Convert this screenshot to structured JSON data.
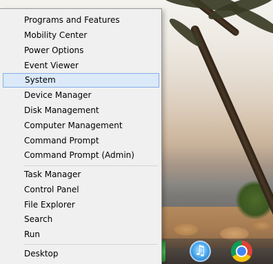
{
  "context_menu": {
    "items": [
      {
        "id": "programs-features",
        "label": "Programs and Features"
      },
      {
        "id": "mobility-center",
        "label": "Mobility Center"
      },
      {
        "id": "power-options",
        "label": "Power Options"
      },
      {
        "id": "event-viewer",
        "label": "Event Viewer"
      },
      {
        "id": "system",
        "label": "System",
        "highlighted": true
      },
      {
        "id": "device-manager",
        "label": "Device Manager"
      },
      {
        "id": "disk-management",
        "label": "Disk Management"
      },
      {
        "id": "computer-management",
        "label": "Computer Management"
      },
      {
        "id": "command-prompt",
        "label": "Command Prompt"
      },
      {
        "id": "command-prompt-admin",
        "label": "Command Prompt (Admin)"
      },
      {
        "id": "task-manager",
        "label": "Task Manager"
      },
      {
        "id": "control-panel",
        "label": "Control Panel"
      },
      {
        "id": "file-explorer",
        "label": "File Explorer"
      },
      {
        "id": "search",
        "label": "Search"
      },
      {
        "id": "run",
        "label": "Run"
      },
      {
        "id": "desktop",
        "label": "Desktop"
      }
    ]
  },
  "taskbar": {
    "pinned": [
      {
        "icon": "green-app-icon"
      },
      {
        "icon": "itunes-icon"
      },
      {
        "icon": "chrome-icon"
      }
    ]
  },
  "colors": {
    "menu_background": "#f0f0f0",
    "hover_fill": "#dbe9f8",
    "hover_border": "#84ade6"
  }
}
